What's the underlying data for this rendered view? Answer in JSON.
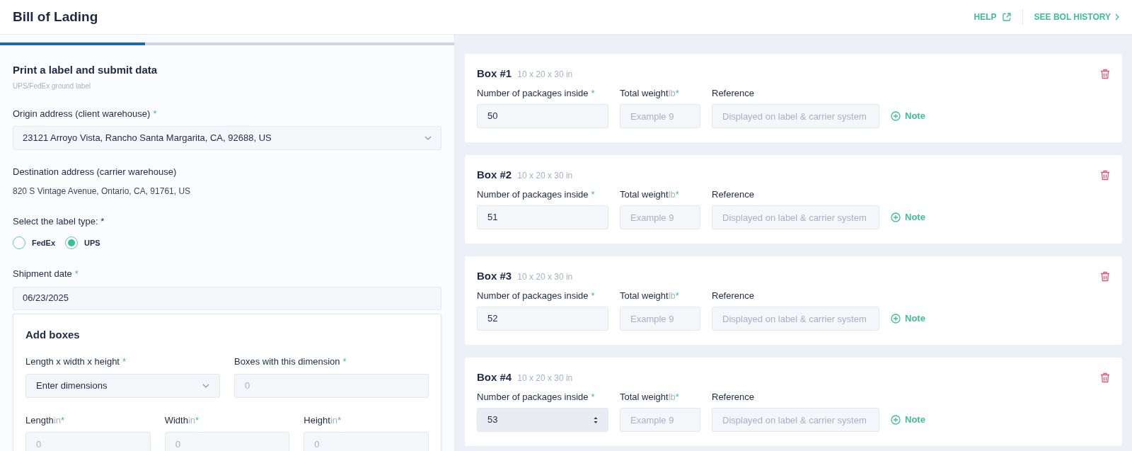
{
  "header": {
    "title": "Bill of Lading",
    "help": "HELP",
    "history": "SEE BOL HISTORY"
  },
  "progress": {
    "level": 0.32
  },
  "form": {
    "title": "Print a label and submit data",
    "subtitle": "UPS/FedEx ground label",
    "origin": {
      "label": "Origin address (client warehouse)",
      "required": "*",
      "value": "23121 Arroyo Vista, Rancho Santa Margarita, CA, 92688, US"
    },
    "destination": {
      "label": "Destination address (carrier warehouse)",
      "value": "820 S Vintage Avenue, Ontario, CA, 91761, US"
    },
    "label_type": {
      "label": "Select the label type: *",
      "options": [
        {
          "label": "FedEx",
          "selected": false
        },
        {
          "label": "UPS",
          "selected": true
        }
      ]
    },
    "shipment_date": {
      "label": "Shipment date",
      "required": "*",
      "value": "06/23/2025"
    }
  },
  "add_boxes": {
    "title": "Add boxes",
    "dimension": {
      "label": "Length x width x height",
      "required": "*",
      "value": "Enter dimensions"
    },
    "count": {
      "label": "Boxes with this dimension",
      "required": "*",
      "placeholder": "0"
    },
    "sizes": [
      {
        "label": "Length",
        "unit": "in",
        "required": "*",
        "placeholder": "0"
      },
      {
        "label": "Width",
        "unit": "in",
        "required": "*",
        "placeholder": "0"
      },
      {
        "label": "Height",
        "unit": "in",
        "required": "*",
        "placeholder": "0"
      }
    ]
  },
  "boxes": [
    {
      "title": "Box #1",
      "dims": "10 x 20 x 30 in",
      "packages_label": "Number of packages inside",
      "packages_required": "*",
      "packages": "50",
      "focused": false,
      "weight_label": "Total weight",
      "weight_unit": "lb",
      "weight_required": "*",
      "weight_placeholder": "Example 9",
      "reference_label": "Reference",
      "reference_placeholder": "Displayed on label & carrier system",
      "note": "Note"
    },
    {
      "title": "Box #2",
      "dims": "10 x 20 x 30 in",
      "packages_label": "Number of packages inside",
      "packages_required": "*",
      "packages": "51",
      "focused": false,
      "weight_label": "Total weight",
      "weight_unit": "lb",
      "weight_required": "*",
      "weight_placeholder": "Example 9",
      "reference_label": "Reference",
      "reference_placeholder": "Displayed on label & carrier system",
      "note": "Note"
    },
    {
      "title": "Box #3",
      "dims": "10 x 20 x 30 in",
      "packages_label": "Number of packages inside",
      "packages_required": "*",
      "packages": "52",
      "focused": false,
      "weight_label": "Total weight",
      "weight_unit": "lb",
      "weight_required": "*",
      "weight_placeholder": "Example 9",
      "reference_label": "Reference",
      "reference_placeholder": "Displayed on label & carrier system",
      "note": "Note"
    },
    {
      "title": "Box #4",
      "dims": "10 x 20 x 30 in",
      "packages_label": "Number of packages inside",
      "packages_required": "*",
      "packages": "53",
      "focused": true,
      "weight_label": "Total weight",
      "weight_unit": "lb",
      "weight_required": "*",
      "weight_placeholder": "Example 9",
      "reference_label": "Reference",
      "reference_placeholder": "Displayed on label & carrier system",
      "note": "Note"
    }
  ]
}
